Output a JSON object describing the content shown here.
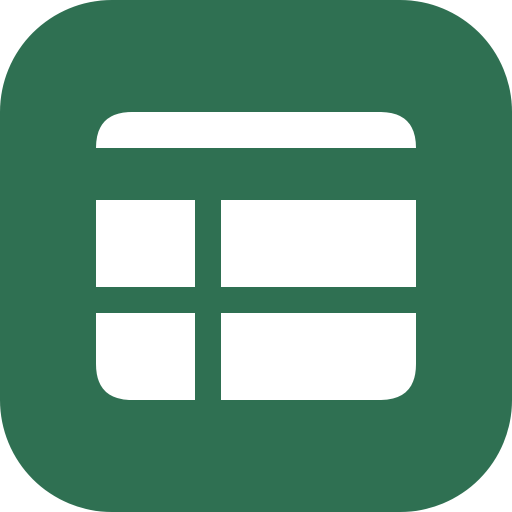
{
  "icon": {
    "name": "spreadsheet-icon",
    "colors": {
      "background": "#2f7052",
      "glyph": "#ffffff"
    }
  }
}
